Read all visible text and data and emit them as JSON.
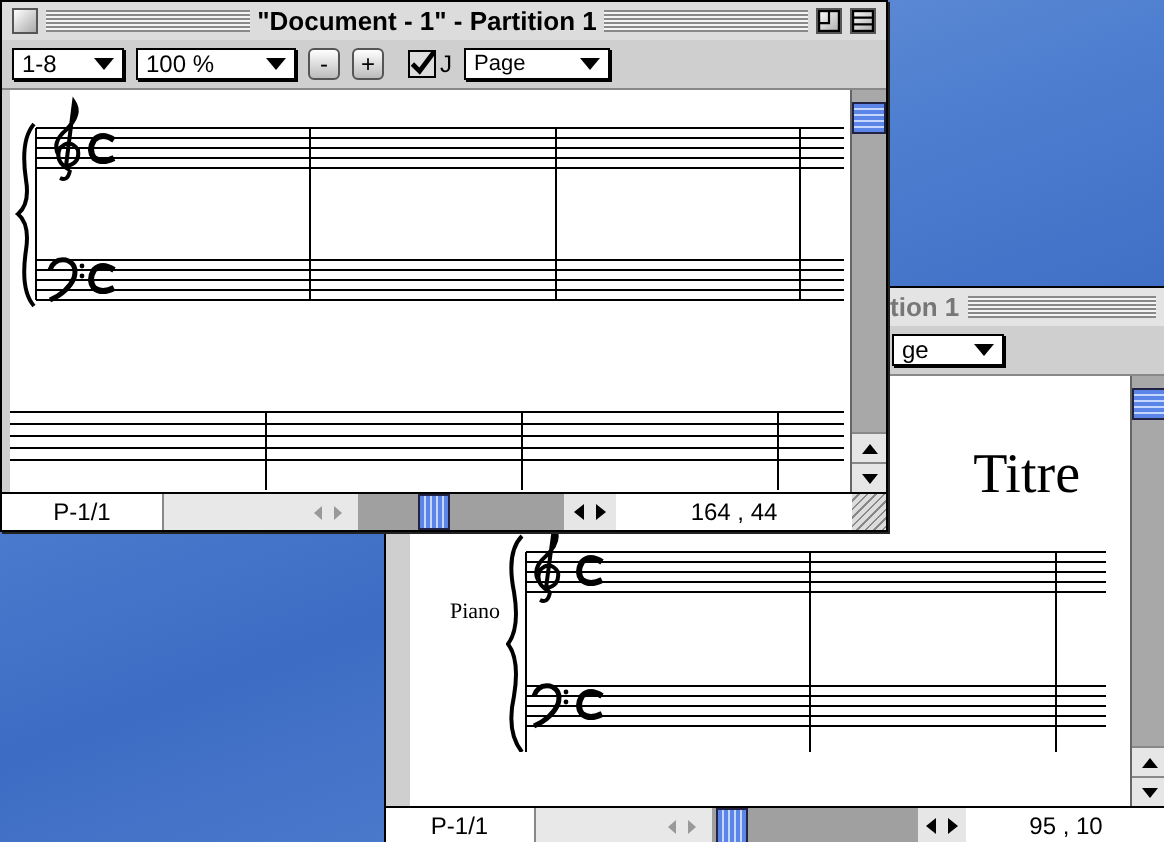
{
  "back_window": {
    "title": "tion 1",
    "view": "ge",
    "score_title": "Titre",
    "instrument": "Piano",
    "page_indicator": "P-1/1",
    "coordinates": "95 , 10"
  },
  "front_window": {
    "title": "\"Document - 1\" - Partition 1",
    "measure_range": "1-8",
    "zoom": "100 %",
    "zoom_out": "-",
    "zoom_in": "+",
    "checkbox": {
      "label": "J",
      "checked": true
    },
    "view": "Page",
    "page_indicator": "P-1/1",
    "coordinates": "164 , 44"
  }
}
